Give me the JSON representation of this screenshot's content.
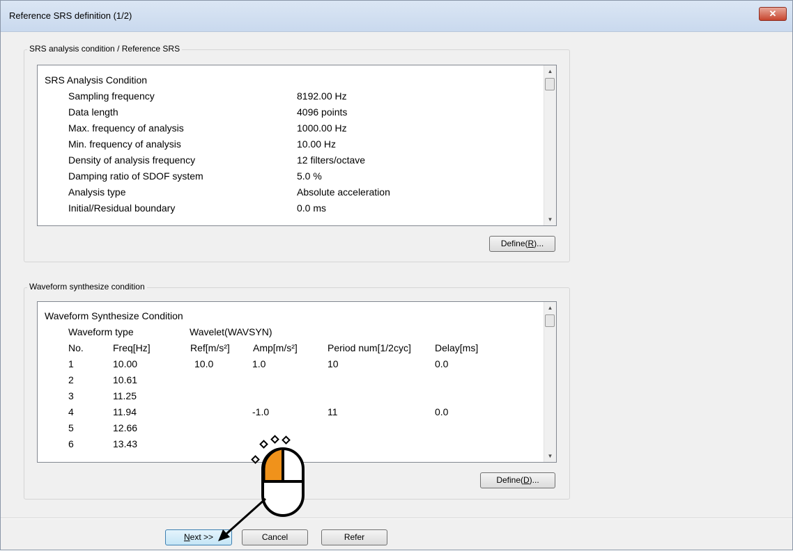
{
  "window": {
    "title": "Reference SRS definition (1/2)",
    "close_label": "✕"
  },
  "srs_group": {
    "label": "SRS analysis condition / Reference SRS",
    "heading": "SRS Analysis Condition",
    "rows": [
      {
        "name": "Sampling frequency",
        "value": "8192.00 Hz"
      },
      {
        "name": "Data length",
        "value": "4096 points"
      },
      {
        "name": "Max. frequency of analysis",
        "value": "1000.00 Hz"
      },
      {
        "name": "Min. frequency of analysis",
        "value": "10.00 Hz"
      },
      {
        "name": "Density of analysis frequency",
        "value": "12 filters/octave"
      },
      {
        "name": "Damping ratio of SDOF system",
        "value": "5.0 %"
      },
      {
        "name": "Analysis type",
        "value": "Absolute acceleration"
      },
      {
        "name": "Initial/Residual boundary",
        "value": "0.0 ms"
      }
    ],
    "define_button": {
      "prefix": "Define(",
      "mnemonic": "R",
      "suffix": ")..."
    }
  },
  "wave_group": {
    "label": "Waveform synthesize condition",
    "heading": "Waveform Synthesize Condition",
    "type_label": "Waveform type",
    "type_value": "Wavelet(WAVSYN)",
    "columns": [
      "No.",
      "Freq[Hz]",
      "Ref[m/s²]",
      "Amp[m/s²]",
      "Period num[1/2cyc]",
      "Delay[ms]"
    ],
    "rows": [
      [
        "1",
        "10.00",
        "10.0",
        "1.0",
        "10",
        "0.0"
      ],
      [
        "2",
        "10.61",
        "",
        "",
        "",
        ""
      ],
      [
        "3",
        "11.25",
        "",
        "",
        "",
        ""
      ],
      [
        "4",
        "11.94",
        "",
        "-1.0",
        "11",
        "0.0"
      ],
      [
        "5",
        "12.66",
        "",
        "",
        "",
        ""
      ],
      [
        "6",
        "13.43",
        "",
        "",
        "",
        ""
      ]
    ],
    "define_button": {
      "prefix": "Define(",
      "mnemonic": "D",
      "suffix": ")..."
    }
  },
  "footer": {
    "next": {
      "mnemonic": "N",
      "rest": "ext >>"
    },
    "cancel": "Cancel",
    "refer": "Refer"
  },
  "icons": {
    "scroll_up": "▲",
    "scroll_down": "▼"
  },
  "colors": {
    "mouse_left_button": "#f0921b",
    "title_bar": "#dbe6f4",
    "close_button": "#c7452e"
  }
}
